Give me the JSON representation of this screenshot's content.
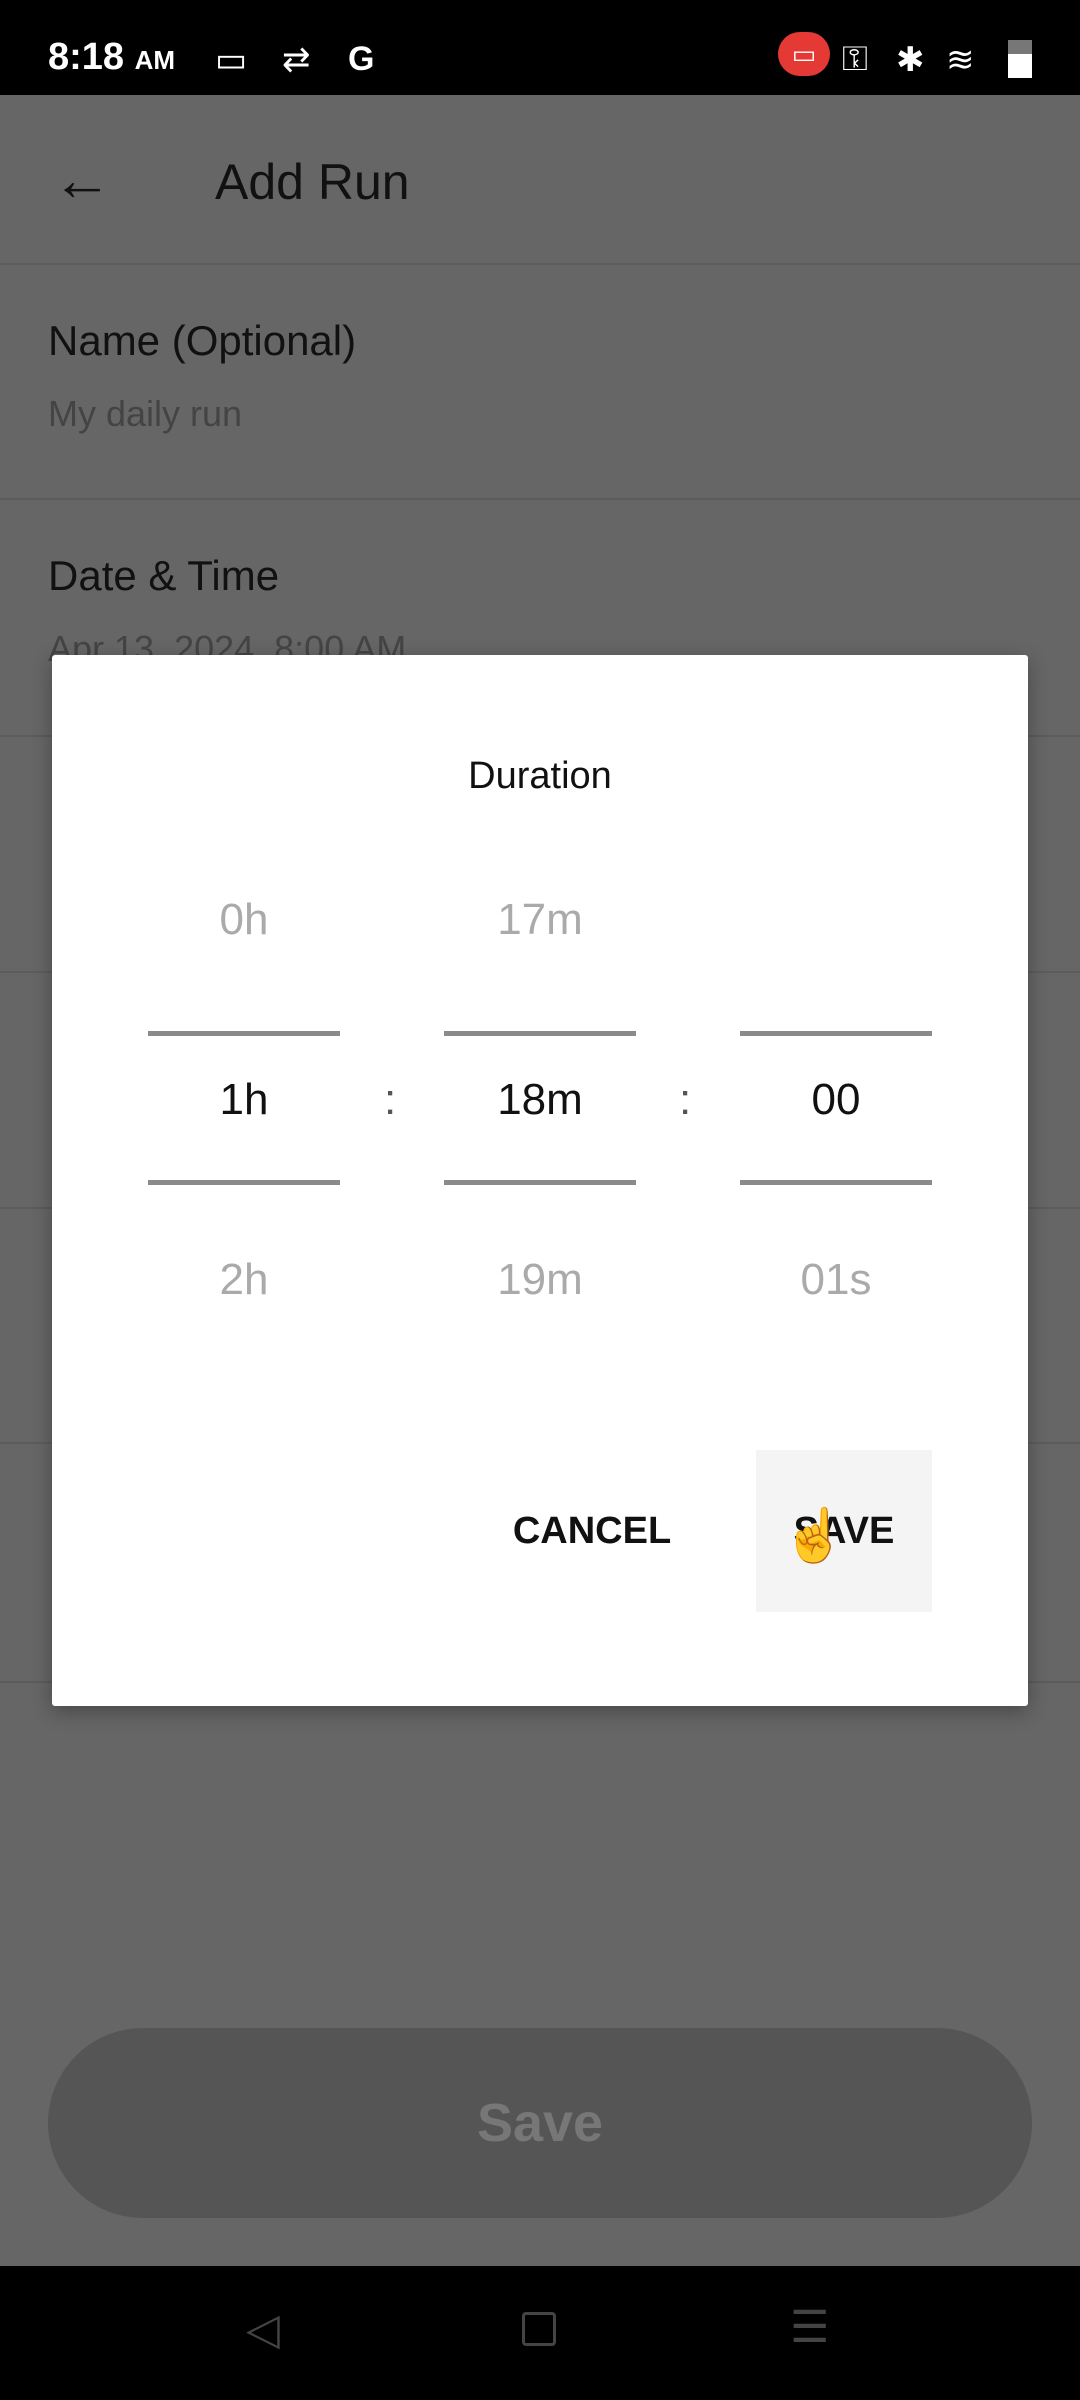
{
  "status_bar": {
    "time": "8:18",
    "ampm": "AM",
    "icons": [
      "screen-record-icon",
      "sync-icon",
      "google-icon",
      "recording-icon",
      "vpn-key-icon",
      "bluetooth-icon",
      "wifi-icon",
      "battery-icon"
    ]
  },
  "header": {
    "title": "Add Run"
  },
  "form": {
    "name_label": "Name (Optional)",
    "name_placeholder": "My daily run",
    "date_label": "Date & Time",
    "date_value": "Apr 13, 2024, 8:00 AM"
  },
  "dialog": {
    "title": "Duration",
    "hours": {
      "prev": "0h",
      "selected": "1h",
      "next": "2h"
    },
    "minutes": {
      "prev": "17m",
      "selected": "18m",
      "next": "19m"
    },
    "seconds": {
      "prev": "",
      "selected": "00",
      "next": "01s"
    },
    "separator": ":",
    "cancel_label": "CANCEL",
    "save_label": "SAVE"
  },
  "save_button": {
    "label": "Save"
  },
  "colors": {
    "overlay": "#666666",
    "dialog": "#ffffff",
    "recording": "#e53935"
  }
}
